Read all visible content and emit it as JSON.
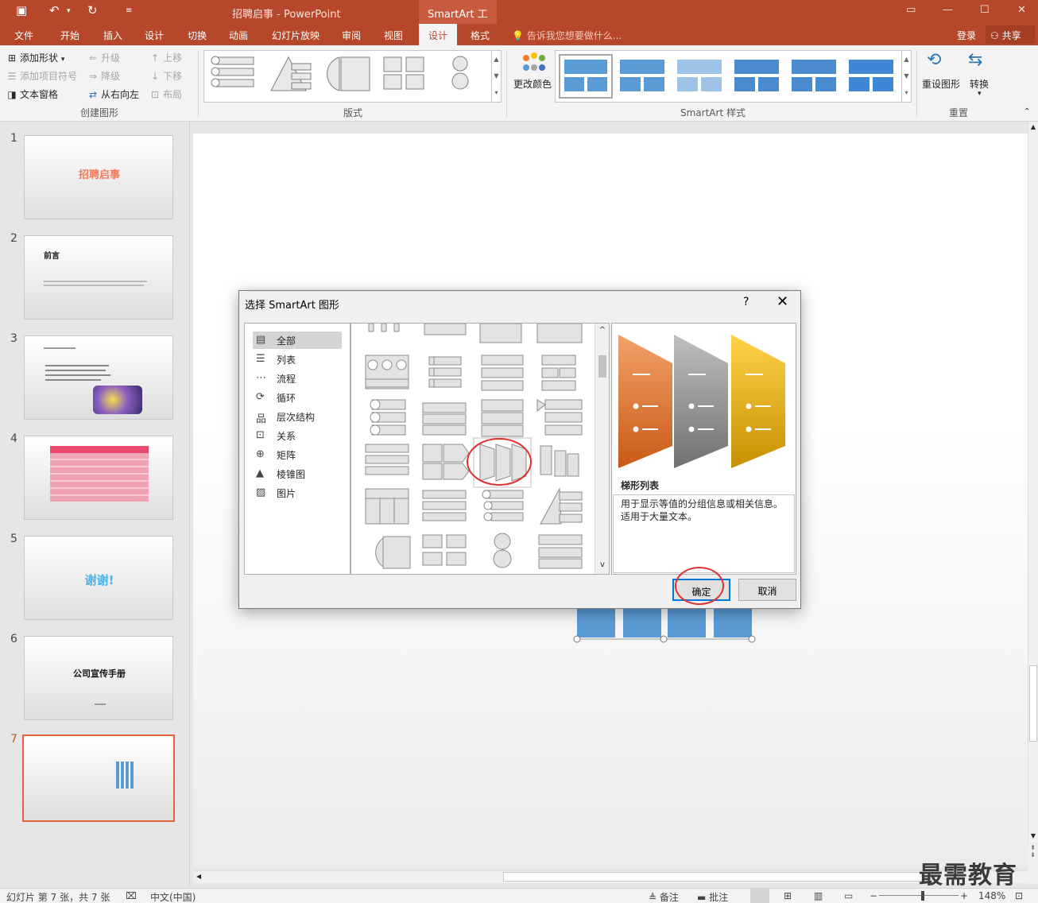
{
  "titlebar": {
    "title": "招聘启事 - PowerPoint",
    "context_tools": "SmartArt 工具"
  },
  "tabs": [
    "文件",
    "开始",
    "插入",
    "设计",
    "切换",
    "动画",
    "幻灯片放映",
    "审阅",
    "视图",
    "设计",
    "格式"
  ],
  "active_tab_index": 9,
  "tell_me": "告诉我您想要做什么...",
  "account": {
    "login": "登录",
    "share": "共享"
  },
  "ribbon": {
    "create_graphic": {
      "add_shape": "添加形状",
      "add_bullet": "添加项目符号",
      "text_pane": "文本窗格",
      "promote": "升级",
      "demote": "降级",
      "right_to_left": "从右向左",
      "move_up": "上移",
      "move_down": "下移",
      "layout": "布局",
      "label": "创建图形"
    },
    "layouts_label": "版式",
    "change_colors": "更改颜色",
    "smartart_styles_label": "SmartArt 样式",
    "reset_graphic": "重设图形",
    "convert": "转换",
    "reset_label": "重置"
  },
  "slides": [
    {
      "num": "1",
      "title": "招聘启事"
    },
    {
      "num": "2",
      "title": "前言"
    },
    {
      "num": "3",
      "title": ""
    },
    {
      "num": "4",
      "title": ""
    },
    {
      "num": "5",
      "title": "谢谢!"
    },
    {
      "num": "6",
      "title": "公司宣传手册"
    },
    {
      "num": "7",
      "title": ""
    }
  ],
  "dialog": {
    "title": "选择 SmartArt 图形",
    "help": "?",
    "categories": [
      {
        "label": "全部",
        "icon": "all-icon"
      },
      {
        "label": "列表",
        "icon": "list-icon"
      },
      {
        "label": "流程",
        "icon": "process-icon"
      },
      {
        "label": "循环",
        "icon": "cycle-icon"
      },
      {
        "label": "层次结构",
        "icon": "hierarchy-icon"
      },
      {
        "label": "关系",
        "icon": "relationship-icon"
      },
      {
        "label": "矩阵",
        "icon": "matrix-icon"
      },
      {
        "label": "棱锥图",
        "icon": "pyramid-icon"
      },
      {
        "label": "图片",
        "icon": "picture-icon"
      }
    ],
    "selected_category_index": 0,
    "preview_name": "梯形列表",
    "preview_desc": "用于显示等值的分组信息或相关信息。适用于大量文本。",
    "ok": "确定",
    "cancel": "取消"
  },
  "statusbar": {
    "slide_info": "幻灯片 第 7 张，共 7 张",
    "language": "中文(中国)",
    "notes": "备注",
    "comments": "批注",
    "zoom": "148%"
  },
  "watermark": "最需教育",
  "colors": {
    "accent": "#b7472a",
    "smartart_blue": "#5b9bd5",
    "trap_orange": "#e8772e",
    "trap_gray": "#8c8c8c",
    "trap_gold": "#f0b81f",
    "highlight_red": "#e0302c"
  }
}
